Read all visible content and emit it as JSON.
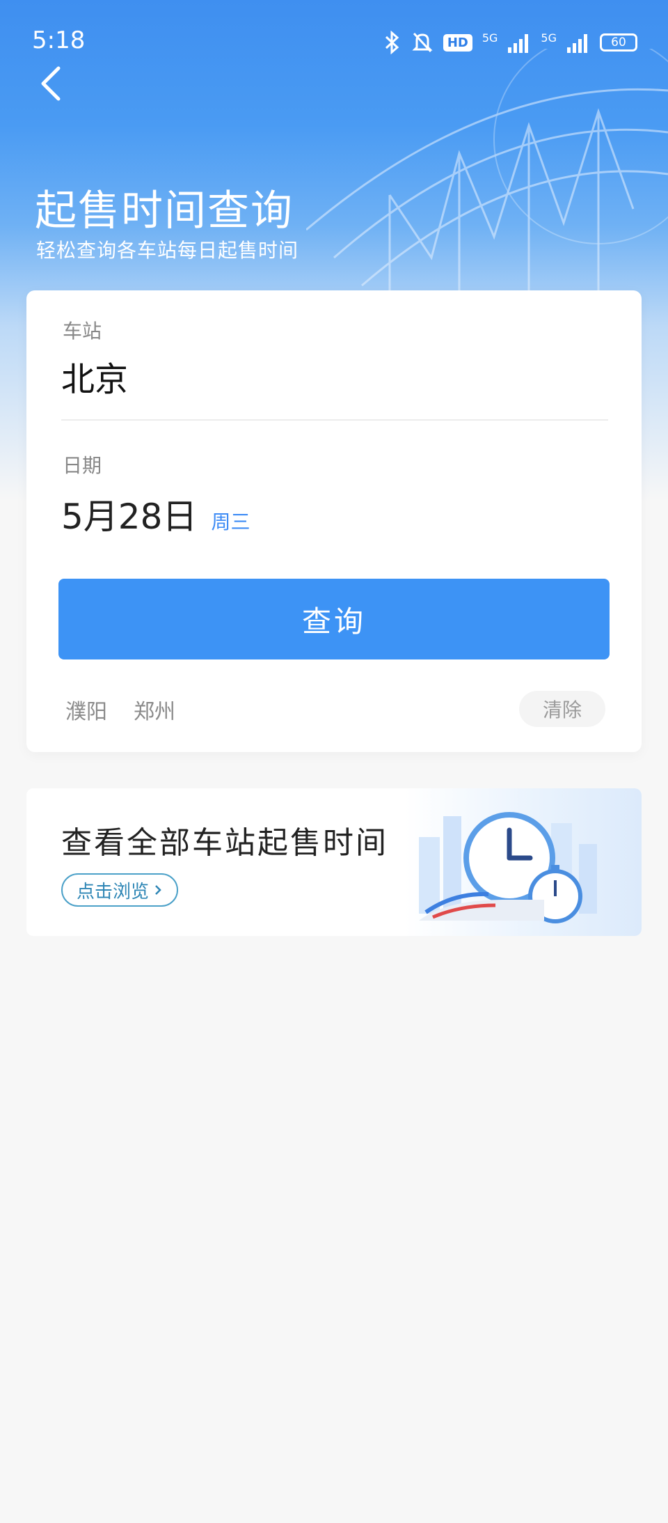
{
  "status_bar": {
    "time": "5:18",
    "network_1": "5G",
    "network_2": "5G",
    "hd_label": "HD",
    "battery": "60"
  },
  "header": {
    "title": "起售时间查询",
    "subtitle": "轻松查询各车站每日起售时间"
  },
  "query_card": {
    "station_label": "车站",
    "station_value": "北京",
    "date_label": "日期",
    "date_value": "5月28日",
    "weekday": "周三",
    "search_button": "查询",
    "history": [
      "濮阳",
      "郑州"
    ],
    "clear_button": "清除"
  },
  "banner": {
    "title": "查看全部车站起售时间",
    "link_label": "点击浏览"
  },
  "colors": {
    "primary": "#3d93f5",
    "hero_top": "#3f8ff0",
    "background": "#f7f7f7",
    "link": "#2e86b5"
  },
  "icons": {
    "back": "back-arrow-icon",
    "bluetooth": "bluetooth-icon",
    "mute": "bell-off-icon",
    "signal": "signal-icon",
    "battery": "battery-icon",
    "chevron": "chevron-right-icon"
  }
}
